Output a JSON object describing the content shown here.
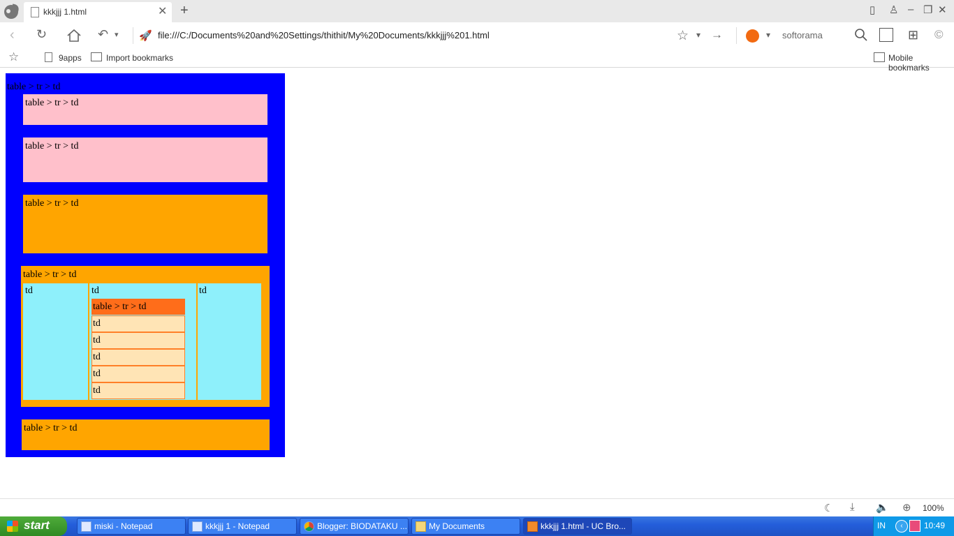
{
  "browser": {
    "tab_title": "kkkjjj 1.html",
    "url": "file:///C:/Documents%20and%20Settings/thithit/My%20Documents/kkkjjj%201.html",
    "search_placeholder": "softorama",
    "bookmarks": [
      "9apps",
      "Import bookmarks"
    ],
    "mobile_bookmarks": "Mobile bookmarks",
    "zoom": "100%",
    "colors": {
      "search_engine": "#f26a11"
    }
  },
  "page": {
    "outer_label": "table > tr > td",
    "pink1_label": "table > tr > td",
    "pink2_label": "table > tr > td",
    "orange1_label": "table > tr > td",
    "section_label": "table > tr > td",
    "left_cell": "td",
    "middle_cell": "td",
    "right_cell": "td",
    "inner_header": "table > tr > td",
    "inner_rows": [
      "td",
      "td",
      "td",
      "td",
      "td"
    ],
    "bottom_label": "table > tr > td",
    "colors": {
      "outer": "#0000ff",
      "pink": "#ffc0cb",
      "orange": "#ffa500",
      "cyan": "#8ef0fb",
      "peach": "#ffe4b5",
      "dark_orange": "#ff6d1a"
    }
  },
  "taskbar": {
    "start_label": "start",
    "items": [
      "miski - Notepad",
      "kkkjjj 1 - Notepad",
      "Blogger: BIODATAKU ...",
      "My Documents",
      "kkkjjj 1.html - UC Bro..."
    ],
    "tray_lang": "IN",
    "clock": "10:49"
  }
}
